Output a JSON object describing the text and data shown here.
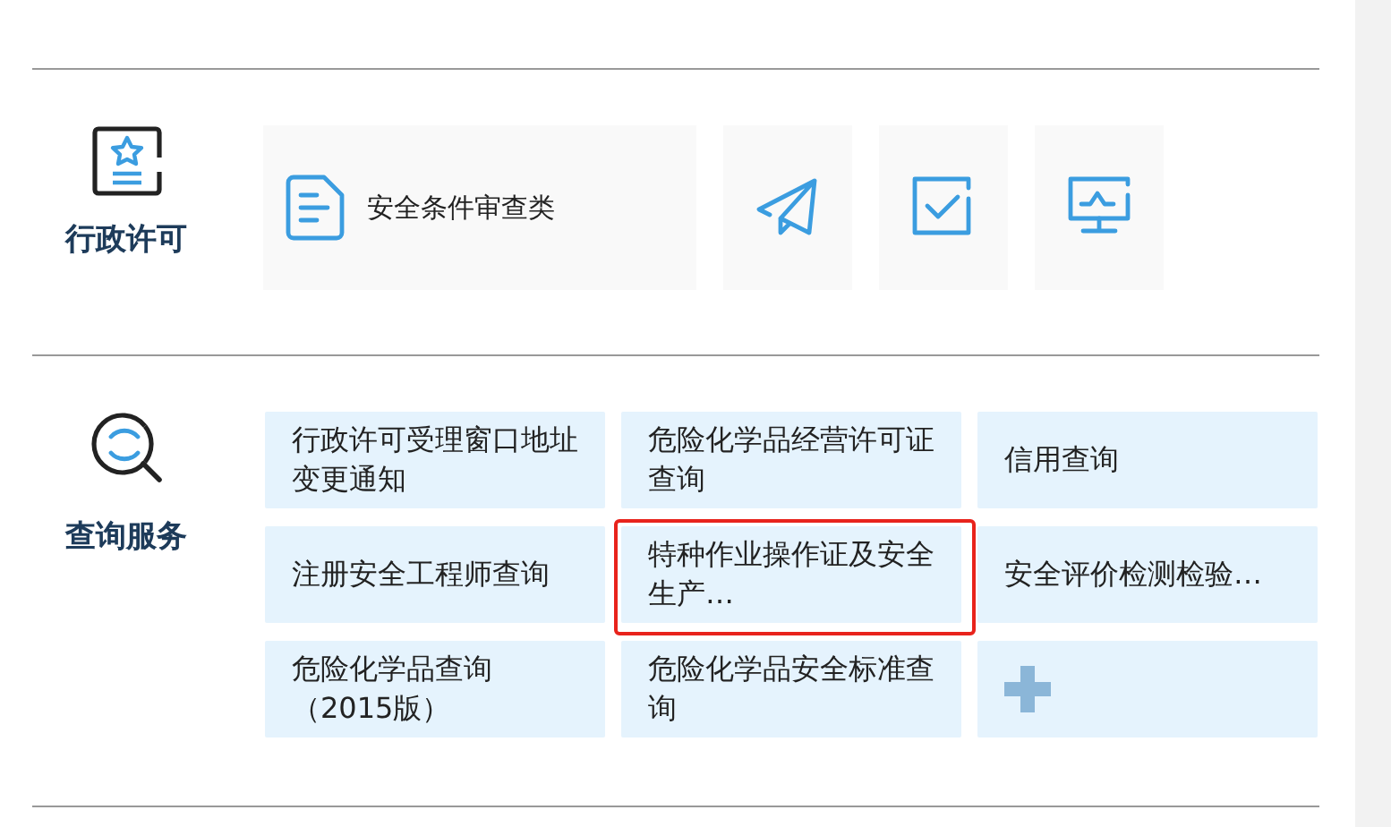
{
  "permit": {
    "title": "行政许可",
    "cards": [
      {
        "label": "安全条件审查类"
      }
    ]
  },
  "query": {
    "title": "查询服务",
    "tiles": [
      {
        "kind": "text",
        "label": "行政许可受理窗口地址变更通知",
        "highlighted": false
      },
      {
        "kind": "text",
        "label": "危险化学品经营许可证查询",
        "highlighted": false
      },
      {
        "kind": "text",
        "label": "信用查询",
        "highlighted": false
      },
      {
        "kind": "text",
        "label": "注册安全工程师查询",
        "highlighted": false
      },
      {
        "kind": "text",
        "label": "特种作业操作证及安全生产…",
        "highlighted": true
      },
      {
        "kind": "text",
        "label": "安全评价检测检验…",
        "highlighted": false
      },
      {
        "kind": "text",
        "label": "危险化学品查询（2015版）",
        "highlighted": false
      },
      {
        "kind": "text",
        "label": "危险化学品安全标准查询",
        "highlighted": false
      },
      {
        "kind": "add",
        "highlighted": false
      }
    ]
  }
}
